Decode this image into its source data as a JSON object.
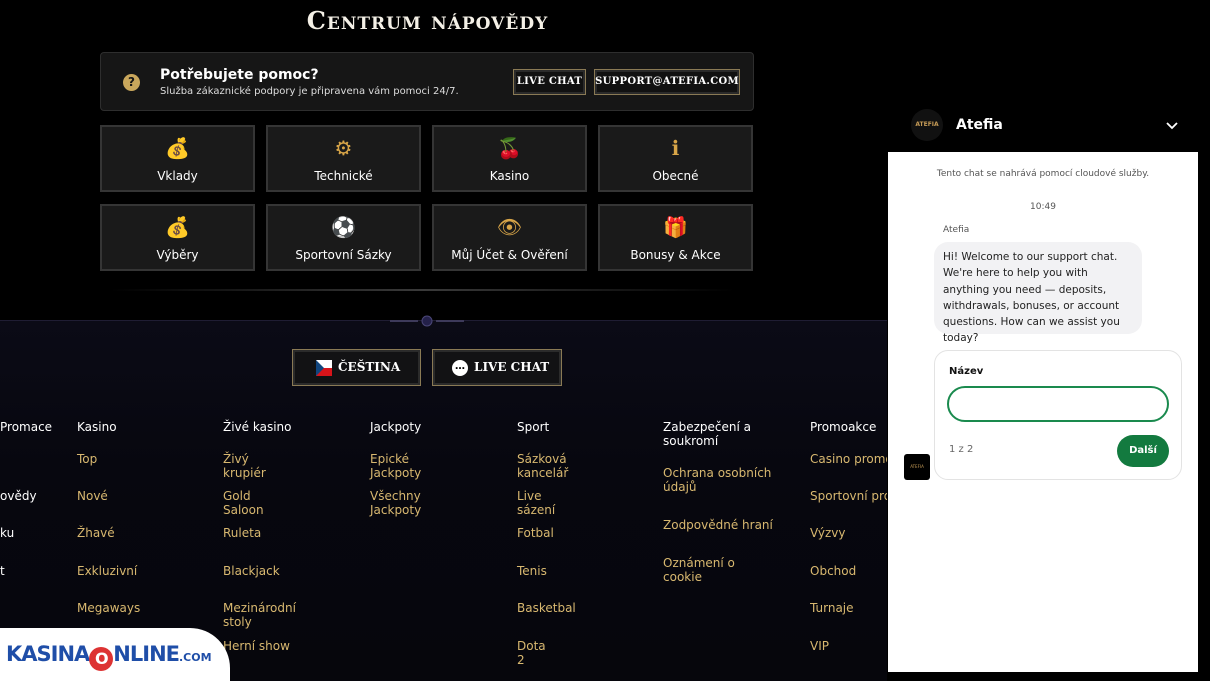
{
  "page_title": "Centrum nápovědy",
  "help_bar": {
    "icon": "question-icon",
    "title": "Potřebujete pomoc?",
    "subtitle": "Služba zákaznické podpory je připravena vám pomoci 24/7.",
    "live_chat_label": "LIVE CHAT",
    "support_email_label": "SUPPORT@ATEFIA.COM"
  },
  "categories": [
    {
      "label": "Vklady",
      "icon": "coins-icon",
      "glyph": "💰"
    },
    {
      "label": "Technické",
      "icon": "gear-icon",
      "glyph": "⚙"
    },
    {
      "label": "Kasino",
      "icon": "cherries-icon",
      "glyph": "🍒"
    },
    {
      "label": "Obecné",
      "icon": "info-icon",
      "glyph": "ℹ"
    },
    {
      "label": "Výběry",
      "icon": "coins-icon",
      "glyph": "💰"
    },
    {
      "label": "Sportovní Sázky",
      "icon": "football-icon",
      "glyph": "⚽"
    },
    {
      "label": "Můj Účet & Ověření",
      "icon": "eye-of-horus-icon",
      "glyph": "👁"
    },
    {
      "label": "Bonusy & Akce",
      "icon": "gift-icon",
      "glyph": "🎁"
    }
  ],
  "footer": {
    "language_label": "ČEŠTINA",
    "live_chat_label": "LIVE CHAT",
    "columns": [
      {
        "head": "",
        "links": [
          "Promace",
          "ovědy",
          "ku",
          "t"
        ]
      },
      {
        "head": "Kasino",
        "links": [
          "Top",
          "Nové",
          "Žhavé",
          "Exkluzivní",
          "Megaways"
        ]
      },
      {
        "head": "Živé kasino",
        "links": [
          "Živý krupiér",
          "Gold Saloon",
          "Ruleta",
          "Blackjack",
          "Mezinárodní stoly",
          "Herní show"
        ]
      },
      {
        "head": "Jackpoty",
        "links": [
          "Epické Jackpoty",
          "Všechny Jackpoty"
        ]
      },
      {
        "head": "Sport",
        "links": [
          "Sázková kancelář",
          "Live sázení",
          "Fotbal",
          "Tenis",
          "Basketbal",
          "Dota 2"
        ]
      },
      {
        "head": "Zabezpečení a soukromí",
        "links": [
          "Ochrana osobních údajů",
          "Zodpovědné hraní",
          "Oznámení o cookie"
        ]
      },
      {
        "head": "Promoakce",
        "links": [
          "Casino promoa",
          "Sportovní prom",
          "Výzvy",
          "Obchod",
          "Turnaje",
          "VIP"
        ]
      }
    ]
  },
  "logo": {
    "text": "KASINA",
    "o": "O",
    "rest": "NLINE",
    "com": ".COM"
  },
  "chat": {
    "avatar_text": "ATEFIA",
    "name": "Atefia",
    "note": "Tento chat se nahrává pomocí cloudové služby.",
    "time": "10:49",
    "sender": "Atefia",
    "message": "Hi! Welcome to our support chat. We're here to help you with anything you need — deposits, withdrawals, bonuses, or account questions. How can we assist you today?",
    "form_label": "Název",
    "form_value": "",
    "step": "1 z 2",
    "next_label": "Další"
  }
}
